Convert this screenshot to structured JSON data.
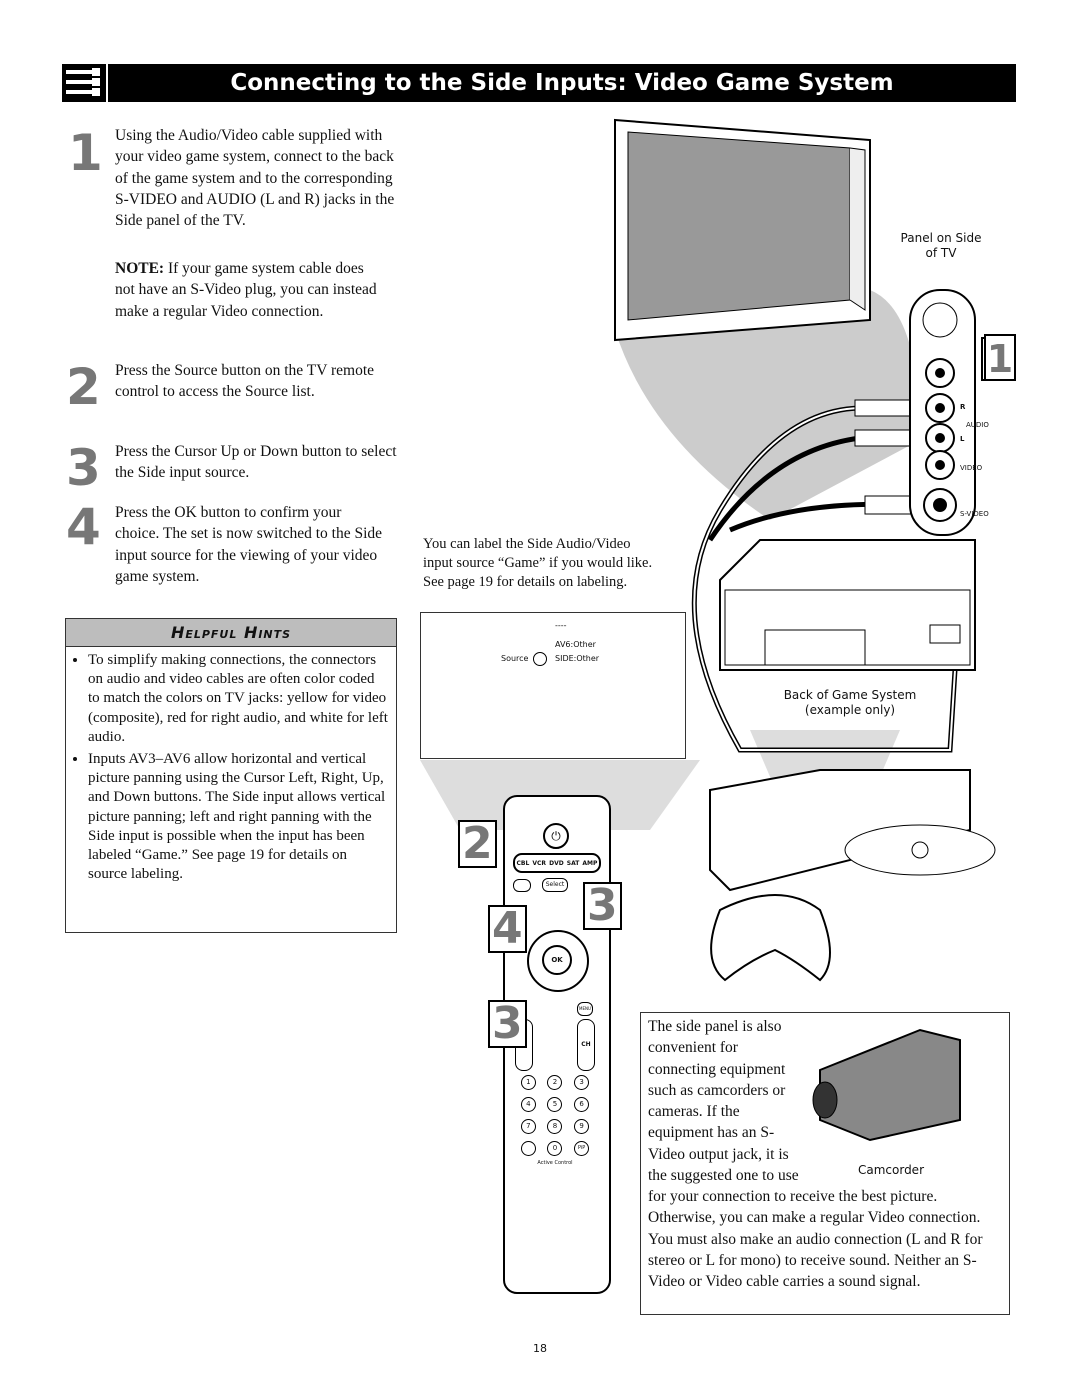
{
  "header": {
    "title": "Connecting to the Side Inputs: Video Game System",
    "icon": "cable-connectors-icon"
  },
  "steps": [
    {
      "number": "1",
      "text": "Using the Audio/Video cable supplied with your video game system, connect to the back of the game system and to the corresponding S-VIDEO and AUDIO (L and R) jacks in the Side panel of the TV.",
      "note_label": "NOTE:",
      "note": " If your game system cable does not have an S-Video plug, you can instead make a regular Video connection."
    },
    {
      "number": "2",
      "text": "Press the Source button on the TV remote control to access the Source list."
    },
    {
      "number": "3",
      "text": "Press the Cursor Up or Down button to select the Side input source."
    },
    {
      "number": "4",
      "text": "Press the OK button to confirm your choice. The set is now switched to the Side input source for the viewing of your video game system."
    }
  ],
  "hints": {
    "title": "Helpful Hints",
    "items": [
      "To simplify making connections, the connectors on audio and video cables are often color coded to match the colors on TV jacks: yellow for video (composite), red for right audio, and white for left audio.",
      "Inputs AV3–AV6 allow horizontal and vertical picture panning using the Cursor Left, Right, Up, and Down buttons. The Side input allows vertical picture panning; left and right panning with the Side input is possible when the input has been labeled “Game.” See page 19 for details on source labeling."
    ]
  },
  "caption": "You can label the Side Audio/Video input source “Game” if you would like. See page 19 for details on labeling.",
  "screen": {
    "dashes": "----",
    "item1": "AV6:Other",
    "item2": "SIDE:Other",
    "source_label": "Source"
  },
  "panel": {
    "label": "Panel on Side of TV",
    "jacks": [
      "AUDIO",
      "VIDEO",
      "S-VIDEO"
    ],
    "r": "R",
    "l": "L",
    "callout": "1"
  },
  "game_system_label": "Back of Game System (example only)",
  "remote": {
    "modes": [
      "CBL",
      "VCR",
      "DVD",
      "SAT",
      "AMP"
    ],
    "select": "Select",
    "ok": "OK",
    "menu": "MENU",
    "ch": "CH",
    "keys": [
      "1",
      "2",
      "3",
      "4",
      "5",
      "6",
      "7",
      "8",
      "9",
      "0"
    ],
    "pip": "PiP",
    "active_control": "Active Control",
    "callouts": [
      "2",
      "3",
      "4",
      "3"
    ]
  },
  "camcorder": {
    "text1": "The side panel is also convenient for connecting equipment such as camcorders or cameras. If the equipment has an S-Video output jack, it is the suggested one to use",
    "text2": "for your connection to receive the best picture. Otherwise, you can make a regular Video connection. You must also make an audio connection (L and R for stereo or L for mono) to receive sound. Neither an S-Video or Video cable carries a sound signal.",
    "label": "Camcorder"
  },
  "page_number": "18"
}
